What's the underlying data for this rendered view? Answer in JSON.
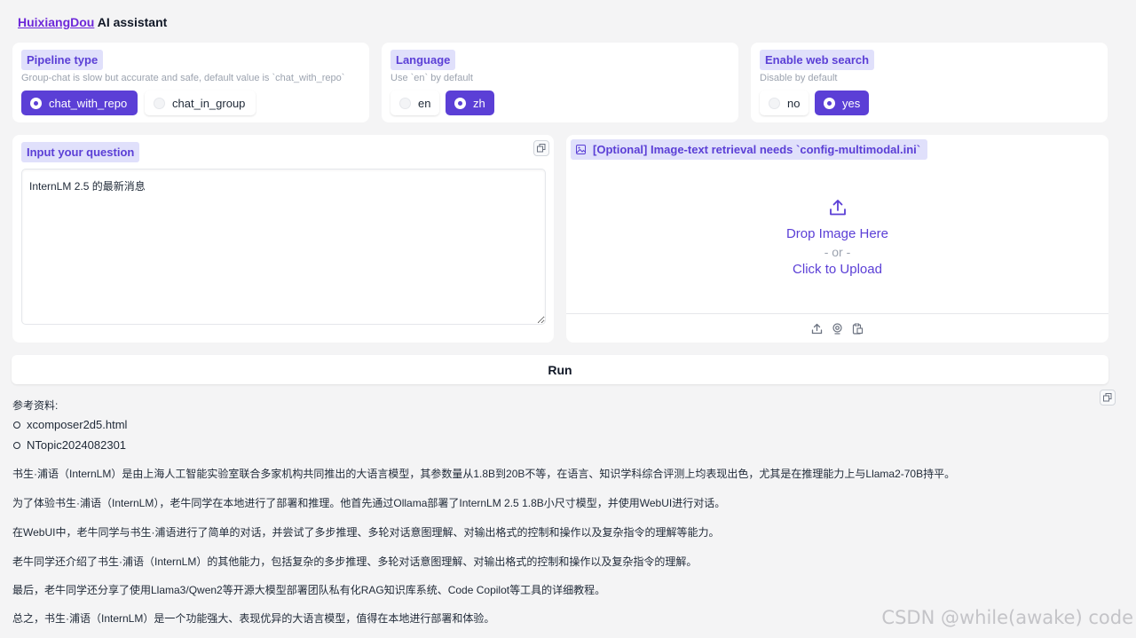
{
  "header": {
    "brand": "HuixiangDou",
    "title_suffix": " AI assistant"
  },
  "pipeline": {
    "label": "Pipeline type",
    "hint": "Group-chat is slow but accurate and safe, default value is `chat_with_repo`",
    "options": [
      {
        "label": "chat_with_repo",
        "selected": true
      },
      {
        "label": "chat_in_group",
        "selected": false
      }
    ]
  },
  "language": {
    "label": "Language",
    "hint": "Use `en` by default",
    "options": [
      {
        "label": "en",
        "selected": false
      },
      {
        "label": "zh",
        "selected": true
      }
    ]
  },
  "web_search": {
    "label": "Enable web search",
    "hint": "Disable by default",
    "options": [
      {
        "label": "no",
        "selected": false
      },
      {
        "label": "yes",
        "selected": true
      }
    ]
  },
  "question": {
    "label": "Input your question",
    "value": "InternLM 2.5 的最新消息"
  },
  "image_upload": {
    "label": "[Optional] Image-text retrieval needs `config-multimodal.ini`",
    "drop_text": "Drop Image Here",
    "or_text": "- or -",
    "click_text": "Click to Upload"
  },
  "run": {
    "label": "Run"
  },
  "output": {
    "refs_title": "参考资料:",
    "references": [
      "xcomposer2d5.html",
      "NTopic2024082301"
    ],
    "paragraphs": [
      "书生·浦语（InternLM）是由上海人工智能实验室联合多家机构共同推出的大语言模型，其参数量从1.8B到20B不等，在语言、知识学科综合评测上均表现出色，尤其是在推理能力上与Llama2-70B持平。",
      "为了体验书生·浦语（InternLM），老牛同学在本地进行了部署和推理。他首先通过Ollama部署了InternLM 2.5 1.8B小尺寸模型，并使用WebUI进行对话。",
      "在WebUI中，老牛同学与书生·浦语进行了简单的对话，并尝试了多步推理、多轮对话意图理解、对输出格式的控制和操作以及复杂指令的理解等能力。",
      "老牛同学还介绍了书生·浦语（InternLM）的其他能力，包括复杂的多步推理、多轮对话意图理解、对输出格式的控制和操作以及复杂指令的理解。",
      "最后，老牛同学还分享了使用Llama3/Qwen2等开源大模型部署团队私有化RAG知识库系统、Code Copilot等工具的详细教程。",
      "总之，书生·浦语（InternLM）是一个功能强大、表现优异的大语言模型，值得在本地进行部署和体验。"
    ]
  },
  "watermark": "CSDN @while(awake) code",
  "colors": {
    "accent": "#5b3fd6",
    "tag_bg": "#e0e0fb",
    "page_bg": "#f4f4f5"
  }
}
